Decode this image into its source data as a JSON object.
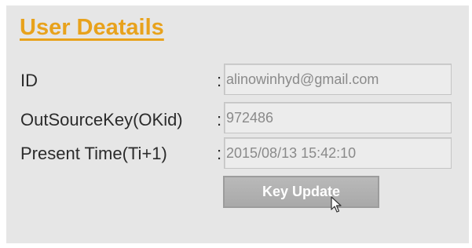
{
  "form": {
    "title": "User Deatails",
    "fields": [
      {
        "label": "ID",
        "colon": ":",
        "value": "alinowinhyd@gmail.com"
      },
      {
        "label": "OutSourceKey(OKid)",
        "colon": ":",
        "value": "972486"
      },
      {
        "label": "Present Time(Ti+1)",
        "colon": ":",
        "value": "2015/08/13 15:42:10"
      }
    ],
    "update_button_label": "Key Update"
  },
  "colors": {
    "title": "#e8a21c",
    "panel_background": "#e6e6e6",
    "button_background": "#b0b0b0"
  },
  "icons": {
    "cursor": "mouse-pointer-icon"
  }
}
